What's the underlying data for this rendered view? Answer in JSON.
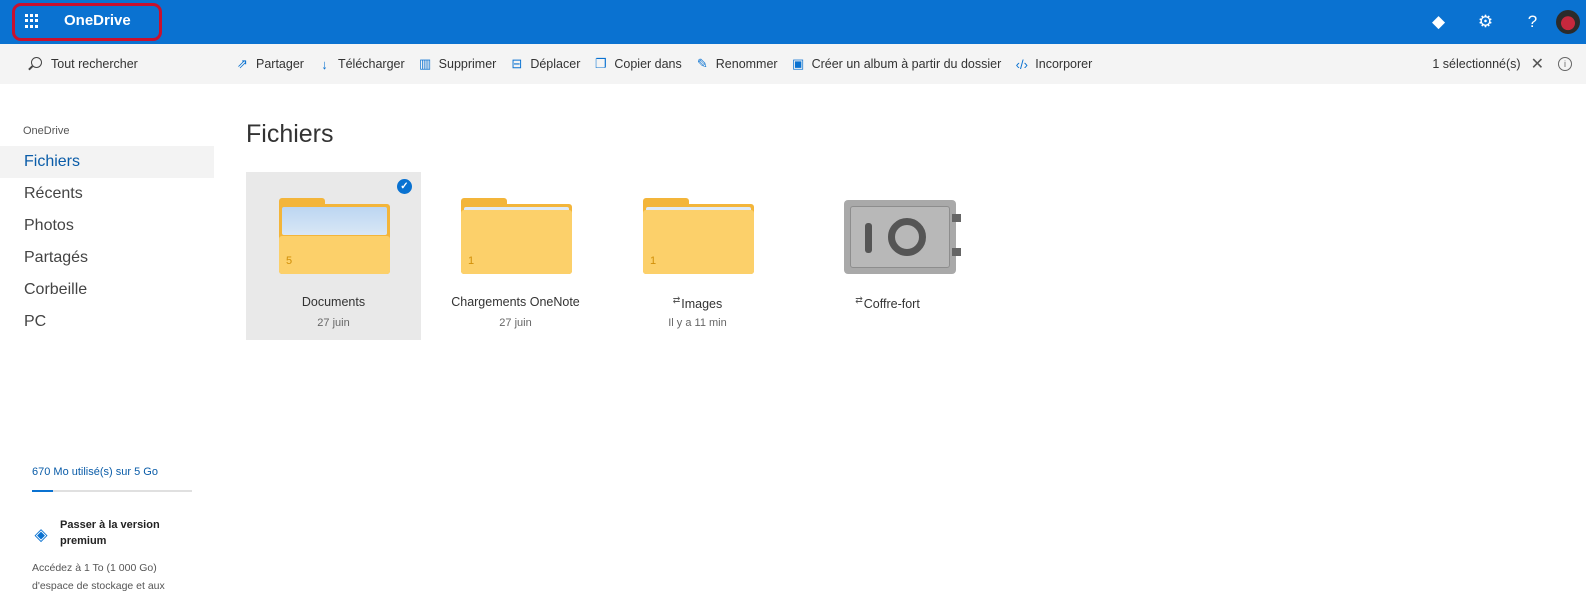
{
  "app": {
    "name": "OneDrive"
  },
  "colors": {
    "accent": "#0a72d1",
    "highlight_border": "#c8102e",
    "folder": "#fcd06a"
  },
  "header": {
    "icons": [
      "diamond-icon",
      "settings-gear-icon",
      "help-icon",
      "avatar"
    ],
    "help_glyph": "?"
  },
  "search": {
    "label": "Tout rechercher"
  },
  "commands": [
    {
      "label": "Partager",
      "icon": "share-icon"
    },
    {
      "label": "Télécharger",
      "icon": "download-icon"
    },
    {
      "label": "Supprimer",
      "icon": "trash-icon"
    },
    {
      "label": "Déplacer",
      "icon": "move-icon"
    },
    {
      "label": "Copier dans",
      "icon": "copy-icon"
    },
    {
      "label": "Renommer",
      "icon": "pencil-icon"
    },
    {
      "label": "Créer un album à partir du dossier",
      "icon": "album-icon"
    },
    {
      "label": "Incorporer",
      "icon": "embed-icon"
    }
  ],
  "selection": {
    "label": "1 sélectionné(s)"
  },
  "sidebar": {
    "section": "OneDrive",
    "items": [
      {
        "label": "Fichiers",
        "active": true
      },
      {
        "label": "Récents"
      },
      {
        "label": "Photos"
      },
      {
        "label": "Partagés"
      },
      {
        "label": "Corbeille"
      },
      {
        "label": "PC"
      }
    ],
    "storage": {
      "label": "670 Mo utilisé(s) sur 5 Go",
      "used_fraction": 0.13
    },
    "premium": {
      "title": "Passer à la version premium",
      "description": "Accédez à 1 To (1 000 Go) d'espace de stockage et aux"
    }
  },
  "main": {
    "title": "Fichiers",
    "items": [
      {
        "name": "Documents",
        "date": "27 juin",
        "count": "5",
        "selected": true,
        "shared": false
      },
      {
        "name": "Chargements OneNote",
        "date": "27 juin",
        "count": "1",
        "selected": false,
        "shared": false
      },
      {
        "name": "Images",
        "date": "Il y a 11 min",
        "count": "1",
        "selected": false,
        "shared": true
      },
      {
        "name": "Coffre-fort",
        "date": "",
        "selected": false,
        "shared": true
      }
    ],
    "shared_glyph": "⇄"
  }
}
